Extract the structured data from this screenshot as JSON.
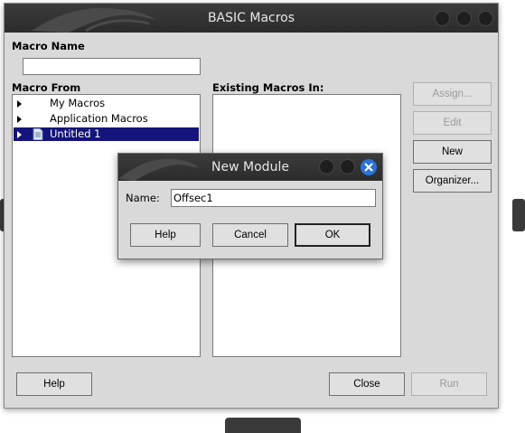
{
  "main": {
    "title": "BASIC Macros",
    "macro_name_label": "Macro Name",
    "macro_name_value": "",
    "macro_from_label": "Macro From",
    "existing_macros_label": "Existing Macros In:",
    "tree": [
      {
        "label": "My Macros"
      },
      {
        "label": "Application Macros"
      },
      {
        "label": "Untitled 1",
        "selected": true
      }
    ],
    "buttons": {
      "assign": "Assign...",
      "edit": "Edit",
      "new": "New",
      "organizer": "Organizer...",
      "help": "Help",
      "close": "Close",
      "run": "Run"
    }
  },
  "dialog": {
    "title": "New Module",
    "name_label": "Name:",
    "name_value": "Offsec1",
    "buttons": {
      "help": "Help",
      "cancel": "Cancel",
      "ok": "OK"
    }
  },
  "colors": {
    "titlebar": "#2f2f2f",
    "window_bg": "#d9d9d9",
    "selection": "#14147a",
    "close_accent": "#2a74d6"
  }
}
